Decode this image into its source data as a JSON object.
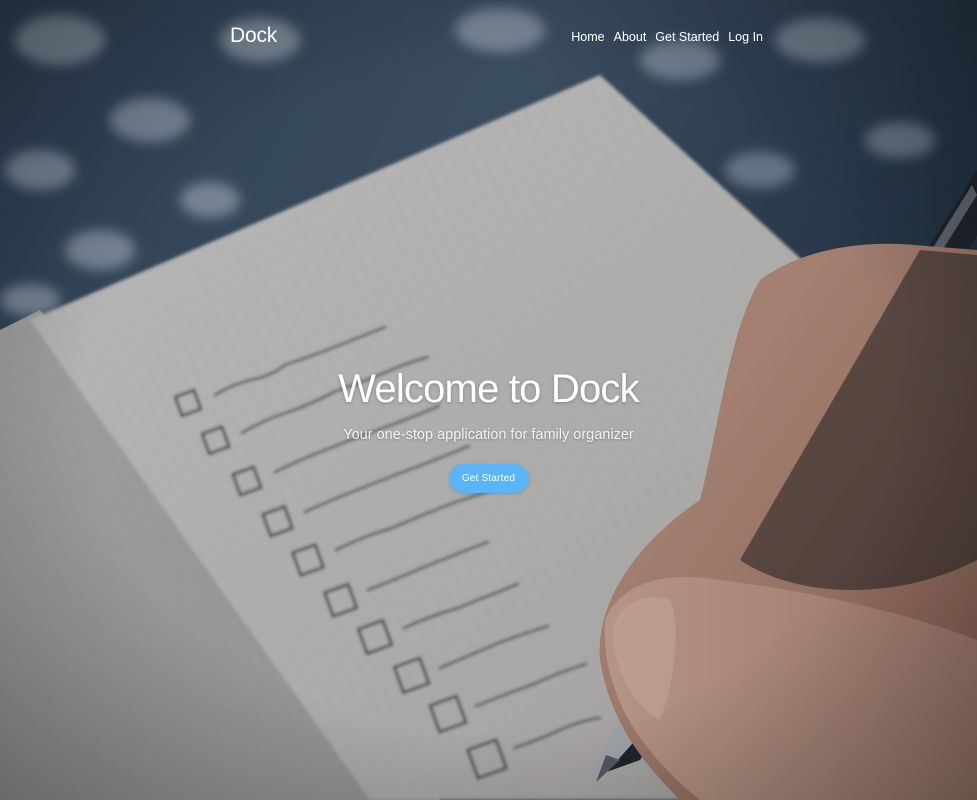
{
  "brand": {
    "name": "Dock"
  },
  "nav": {
    "items": [
      {
        "label": "Home"
      },
      {
        "label": "About"
      },
      {
        "label": "Get Started"
      },
      {
        "label": "Log In"
      }
    ]
  },
  "hero": {
    "title": "Welcome to Dock",
    "subtitle": "Your one-stop application for family organizer",
    "cta_label": "Get Started"
  },
  "colors": {
    "accent": "#5bb4f5",
    "text": "#ffffff"
  }
}
